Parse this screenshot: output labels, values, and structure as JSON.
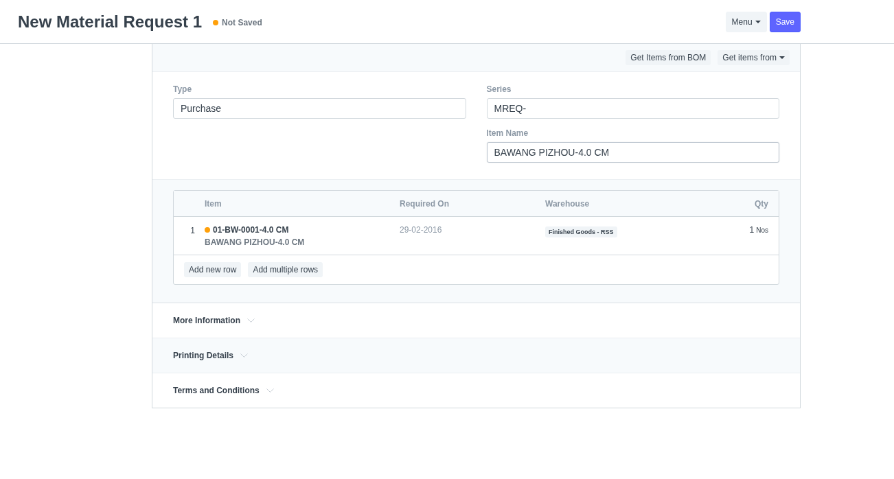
{
  "header": {
    "title": "New Material Request 1",
    "status": {
      "label": "Not Saved",
      "color": "#ffa00a"
    },
    "buttons": [
      {
        "label": "Menu",
        "kind": "dropdown"
      },
      {
        "label": "Save",
        "kind": "primary"
      }
    ]
  },
  "toolbar": {
    "buttons": [
      {
        "label": "Get Items from BOM",
        "kind": "plain"
      },
      {
        "label": "Get items from",
        "kind": "dropdown"
      }
    ]
  },
  "fields": {
    "left": [
      {
        "label": "Type",
        "value": "Purchase",
        "focused": false
      }
    ],
    "right": [
      {
        "label": "Series",
        "value": "MREQ-",
        "focused": false
      },
      {
        "label": "Item Name",
        "value": "BAWANG PIZHOU-4.0 CM",
        "focused": true
      }
    ]
  },
  "table": {
    "columns": [
      "Item",
      "Required On",
      "Warehouse",
      "Qty"
    ],
    "rows": [
      {
        "index": "1",
        "color": "#ffa00a",
        "item_code": "01-BW-0001-4.0 CM",
        "item_name": "BAWANG PIZHOU-4.0 CM",
        "required_on": "29-02-2016",
        "warehouse": "Finished Goods - RSS",
        "qty": "1",
        "uom": "Nos"
      }
    ],
    "buttons": [
      "Add new row",
      "Add multiple rows"
    ]
  },
  "sections": [
    {
      "label": "More Information"
    },
    {
      "label": "Printing Details"
    },
    {
      "label": "Terms and Conditions"
    }
  ]
}
